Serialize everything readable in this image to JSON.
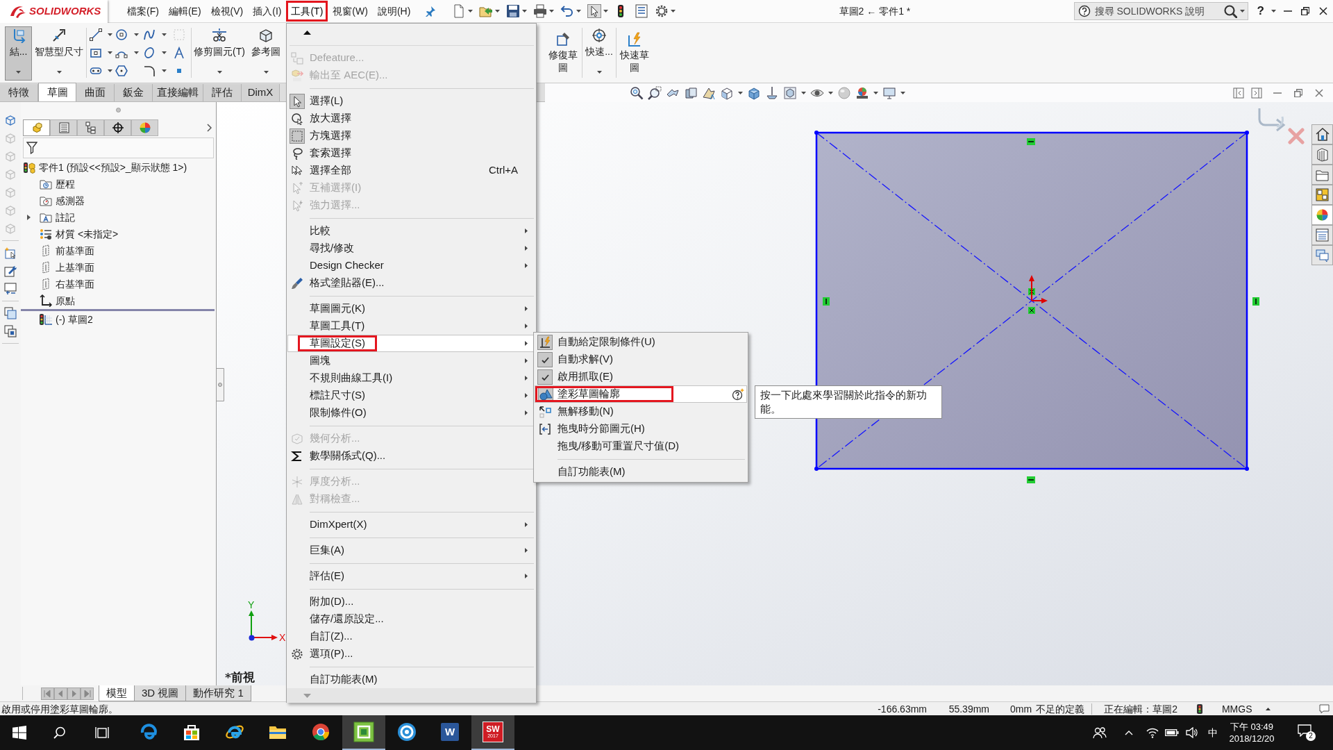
{
  "logo": {
    "text": "SOLIDWORKS"
  },
  "menubar": [
    {
      "label": "檔案(F)",
      "selected": false,
      "annotated": false
    },
    {
      "label": "編輯(E)",
      "selected": false,
      "annotated": false
    },
    {
      "label": "檢視(V)",
      "selected": false,
      "annotated": false
    },
    {
      "label": "插入(I)",
      "selected": false,
      "annotated": false
    },
    {
      "label": "工具(T)",
      "selected": true,
      "annotated": true
    },
    {
      "label": "視窗(W)",
      "selected": false,
      "annotated": false
    },
    {
      "label": "說明(H)",
      "selected": false,
      "annotated": false
    }
  ],
  "document_title": "草圖2 ← 零件1 *",
  "help_search": {
    "placeholder": "搜尋 SOLIDWORKS 說明"
  },
  "help_button": {
    "label": "?"
  },
  "ribbon": {
    "groups": [
      [
        {
          "label": "結...",
          "selected": true
        },
        {
          "label": "智慧型尺寸",
          "selected": false
        }
      ],
      [
        {
          "label": "修剪圖元(T)",
          "selected": false
        },
        {
          "label": "參考圖",
          "selected": false
        }
      ],
      [
        {
          "label": "修復草圖",
          "selected": false
        },
        {
          "label": "快速...",
          "selected": false
        },
        {
          "label": "快速草圖",
          "selected": false
        }
      ]
    ]
  },
  "command_tabs": [
    {
      "label": "特徵",
      "selected": false
    },
    {
      "label": "草圖",
      "selected": true
    },
    {
      "label": "曲面",
      "selected": false
    },
    {
      "label": "鈑金",
      "selected": false
    },
    {
      "label": "直接編輯",
      "selected": false
    },
    {
      "label": "評估",
      "selected": false
    },
    {
      "label": "DimX",
      "selected": false
    }
  ],
  "feature_manager": {
    "tabs": [
      {
        "selected": true
      },
      {
        "selected": false
      },
      {
        "selected": false
      },
      {
        "selected": false
      },
      {
        "selected": false
      }
    ],
    "tree": {
      "label": "零件1  (預設<<預設>_顯示狀態 1>)",
      "children": [
        {
          "label": "歷程",
          "collapsed": false
        },
        {
          "label": "感測器",
          "collapsed": false
        },
        {
          "label": "註記",
          "collapsed": true
        },
        {
          "label": "材質 <未指定>",
          "collapsed": false
        },
        {
          "label": "前基準面",
          "collapsed": false
        },
        {
          "label": "上基準面",
          "collapsed": false
        },
        {
          "label": "右基準面",
          "collapsed": false
        },
        {
          "label": "原點",
          "collapsed": false
        },
        {
          "label": "(-) 草圖2",
          "collapsed": false
        }
      ]
    }
  },
  "view_tabs": [
    {
      "label": "模型",
      "selected": true
    },
    {
      "label": "3D 視圖",
      "selected": false
    },
    {
      "label": "動作研究 1",
      "selected": false
    }
  ],
  "graphics": {
    "view_name": "*前視",
    "triad": {
      "y_label": "Y",
      "x_label": "X"
    }
  },
  "tools_menu": {
    "groups": [
      [
        {
          "label": "Defeature...",
          "disabled": true,
          "checked": false,
          "submenu": false,
          "selected": false,
          "annotated": false
        },
        {
          "label": "輸出至 AEC(E)...",
          "disabled": true,
          "checked": false,
          "submenu": false,
          "selected": false,
          "annotated": false
        }
      ],
      [
        {
          "label": "選擇(L)",
          "disabled": false,
          "checked": true,
          "submenu": false,
          "selected": false,
          "annotated": false
        },
        {
          "label": "放大選擇",
          "disabled": false,
          "checked": false,
          "submenu": false,
          "selected": false,
          "annotated": false
        },
        {
          "label": "方塊選擇",
          "disabled": false,
          "checked": true,
          "submenu": false,
          "selected": false,
          "annotated": false
        },
        {
          "label": "套索選擇",
          "disabled": false,
          "checked": false,
          "submenu": false,
          "selected": false,
          "annotated": false
        },
        {
          "label": "選擇全部",
          "shortcut": "Ctrl+A",
          "disabled": false,
          "checked": false,
          "submenu": false,
          "selected": false,
          "annotated": false
        },
        {
          "label": "互補選擇(I)",
          "disabled": true,
          "checked": false,
          "submenu": false,
          "selected": false,
          "annotated": false
        },
        {
          "label": "強力選擇...",
          "disabled": true,
          "checked": false,
          "submenu": false,
          "selected": false,
          "annotated": false
        }
      ],
      [
        {
          "label": "比較",
          "disabled": false,
          "checked": false,
          "submenu": true,
          "selected": false,
          "annotated": false
        },
        {
          "label": "尋找/修改",
          "disabled": false,
          "checked": false,
          "submenu": true,
          "selected": false,
          "annotated": false
        },
        {
          "label": "Design Checker",
          "disabled": false,
          "checked": false,
          "submenu": true,
          "selected": false,
          "annotated": false
        },
        {
          "label": "格式塗貼器(E)...",
          "disabled": false,
          "checked": false,
          "submenu": false,
          "selected": false,
          "annotated": false
        }
      ],
      [
        {
          "label": "草圖圖元(K)",
          "disabled": false,
          "checked": false,
          "submenu": true,
          "selected": false,
          "annotated": false
        },
        {
          "label": "草圖工具(T)",
          "disabled": false,
          "checked": false,
          "submenu": true,
          "selected": false,
          "annotated": false
        },
        {
          "label": "草圖設定(S)",
          "disabled": false,
          "checked": false,
          "submenu": true,
          "selected": true,
          "annotated": true
        },
        {
          "label": "圖塊",
          "disabled": false,
          "checked": false,
          "submenu": true,
          "selected": false,
          "annotated": false
        },
        {
          "label": "不規則曲線工具(I)",
          "disabled": false,
          "checked": false,
          "submenu": true,
          "selected": false,
          "annotated": false
        },
        {
          "label": "標註尺寸(S)",
          "disabled": false,
          "checked": false,
          "submenu": true,
          "selected": false,
          "annotated": false
        },
        {
          "label": "限制條件(O)",
          "disabled": false,
          "checked": false,
          "submenu": true,
          "selected": false,
          "annotated": false
        }
      ],
      [
        {
          "label": "幾何分析...",
          "disabled": true,
          "checked": false,
          "submenu": false,
          "selected": false,
          "annotated": false
        },
        {
          "label": "數學關係式(Q)...",
          "disabled": false,
          "checked": false,
          "submenu": false,
          "selected": false,
          "annotated": false
        }
      ],
      [
        {
          "label": "厚度分析...",
          "disabled": true,
          "checked": false,
          "submenu": false,
          "selected": false,
          "annotated": false
        },
        {
          "label": "對稱檢查...",
          "disabled": true,
          "checked": false,
          "submenu": false,
          "selected": false,
          "annotated": false
        }
      ],
      [
        {
          "label": "DimXpert(X)",
          "disabled": false,
          "checked": false,
          "submenu": true,
          "selected": false,
          "annotated": false
        }
      ],
      [
        {
          "label": "巨集(A)",
          "disabled": false,
          "checked": false,
          "submenu": true,
          "selected": false,
          "annotated": false
        }
      ],
      [
        {
          "label": "評估(E)",
          "disabled": false,
          "checked": false,
          "submenu": true,
          "selected": false,
          "annotated": false
        }
      ],
      [
        {
          "label": "附加(D)...",
          "disabled": false,
          "checked": false,
          "submenu": false,
          "selected": false,
          "annotated": false
        },
        {
          "label": "儲存/還原設定...",
          "disabled": false,
          "checked": false,
          "submenu": false,
          "selected": false,
          "annotated": false
        },
        {
          "label": "自訂(Z)...",
          "disabled": false,
          "checked": false,
          "submenu": false,
          "selected": false,
          "annotated": false
        },
        {
          "label": "選項(P)...",
          "disabled": false,
          "checked": false,
          "submenu": false,
          "selected": false,
          "annotated": false
        }
      ],
      [
        {
          "label": "自訂功能表(M)",
          "disabled": false,
          "checked": false,
          "submenu": false,
          "selected": false,
          "annotated": false
        }
      ]
    ]
  },
  "sketch_settings_submenu": {
    "groups": [
      [
        {
          "label": "自動給定限制條件(U)",
          "checked": true,
          "selected": false,
          "annotated": false
        },
        {
          "label": "自動求解(V)",
          "checked": true,
          "selected": false,
          "annotated": false
        },
        {
          "label": "啟用抓取(E)",
          "checked": true,
          "selected": false,
          "annotated": false
        },
        {
          "label": "塗彩草圖輪廓",
          "checked": true,
          "selected": true,
          "annotated": true
        },
        {
          "label": "無解移動(N)",
          "checked": false,
          "selected": false,
          "annotated": false
        },
        {
          "label": "拖曳時分節圖元(H)",
          "checked": false,
          "selected": false,
          "annotated": false
        },
        {
          "label": "拖曳/移動可重置尺寸值(D)",
          "checked": false,
          "selected": false,
          "annotated": false
        }
      ],
      [
        {
          "label": "自訂功能表(M)",
          "checked": false,
          "selected": false,
          "annotated": false
        }
      ]
    ]
  },
  "tooltip": {
    "text": "按一下此處來學習關於此指令的新功能。"
  },
  "status_bar": {
    "message": "啟用或停用塗彩草圖輪廓。",
    "cursor_x": "-166.63mm",
    "cursor_y": "55.39mm",
    "cursor_z": "0mm",
    "sketch_state": "不足的定義",
    "editing": "正在編輯：草圖2",
    "units": "MMGS"
  },
  "taskbar": {
    "apps": [
      {
        "active": false
      },
      {
        "active": false
      },
      {
        "active": false
      },
      {
        "active": false
      },
      {
        "active": false
      },
      {
        "active": true
      },
      {
        "active": false
      },
      {
        "active": false,
        "badge": "W"
      },
      {
        "active": true,
        "badge": "SW",
        "caption": "2017"
      }
    ],
    "input_method": "中",
    "time": "下午 03:49",
    "date": "2018/12/20",
    "notification_count": "2"
  }
}
